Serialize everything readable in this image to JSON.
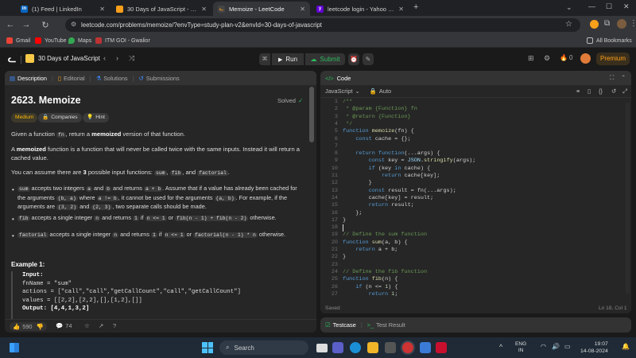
{
  "browser": {
    "tabs": [
      {
        "title": "(1) Feed | LinkedIn",
        "icon": "linkedin-icon"
      },
      {
        "title": "30 Days of JavaScript - Study Pl",
        "icon": "leetcode-icon"
      },
      {
        "title": "Memoize - LeetCode",
        "icon": "leetcode-icon"
      },
      {
        "title": "leetcode login - Yahoo India Se",
        "icon": "yahoo-icon"
      }
    ],
    "url": "leetcode.com/problems/memoize/?envType=study-plan-v2&envId=30-days-of-javascript",
    "bookmarks": [
      "Gmail",
      "YouTube",
      "Maps",
      "ITM GOI - Gwalior"
    ],
    "all_bookmarks": "All Bookmarks"
  },
  "lc_header": {
    "plan": "30 Days of JavaScript",
    "run": "Run",
    "submit": "Submit",
    "coins": "0",
    "premium": "Premium"
  },
  "left_tabs": [
    "Description",
    "Editorial",
    "Solutions",
    "Submissions"
  ],
  "problem": {
    "title": "2623. Memoize",
    "status": "Solved",
    "tags": [
      "Medium",
      "Companies",
      "Hint"
    ],
    "p1a": "Given a function ",
    "p1code": "fn",
    "p1b": ", return a ",
    "p1bold": "memoized",
    "p1c": " version of that function.",
    "p2a": "A ",
    "p2bold": "memoized",
    "p2b": " function is a function that will never be called twice with the same inputs. Instead it will return a",
    "p2c": "cached value.",
    "p3a": "You can assume there are ",
    "p3bold": "3",
    "p3b": " possible input functions: ",
    "p3codes": [
      "sum",
      "fib",
      "factorial"
    ],
    "b1": {
      "c1": "sum",
      "t1": " accepts two integers ",
      "c2": "a",
      "t2": " and ",
      "c3": "b",
      "t3": " and returns ",
      "c4": "a + b",
      "t4": ". Assume that if a value has already been cached for"
    },
    "b1l2": {
      "t1": "the arguments ",
      "c1": "(b, a)",
      "t2": " where ",
      "c2": "a != b",
      "t3": ", it cannot be used for the arguments ",
      "c3": "(a, b)",
      "t4": ". For example, if the"
    },
    "b1l3": {
      "t1": "arguments are ",
      "c1": "(3, 2)",
      "t2": " and ",
      "c2": "(2, 3)",
      "t3": ", two separate calls should be made."
    },
    "b2": {
      "c1": "fib",
      "t1": " accepts a single integer ",
      "c2": "n",
      "t2": " and returns ",
      "c3": "1",
      "t3": " if ",
      "c4": "n <= 1",
      "t4": " or ",
      "c5": "fib(n - 1) + fib(n - 2)",
      "t5": " otherwise."
    },
    "b3": {
      "c1": "factorial",
      "t1": " accepts a single integer ",
      "c2": "n",
      "t2": " and returns ",
      "c3": "1",
      "t3": " if ",
      "c4": "n <= 1",
      "t4": " or ",
      "c5": "factorial(n - 1) * n",
      "t5": " otherwise."
    },
    "example_title": "Example 1:",
    "example_lines": [
      "Input:",
      "fnName = \"sum\"",
      "actions = [\"call\",\"call\",\"getCallCount\",\"call\",\"getCallCount\"]",
      "values = [[2,2],[2,2],[],[1,2],[]]",
      "Output: [4,4,1,3,2]"
    ],
    "likes": "590",
    "comments": "74"
  },
  "editor": {
    "title": "Code",
    "language": "JavaScript",
    "auto": "Auto",
    "saved": "Saved",
    "cursor": "Ln 18, Col 1",
    "lines": [
      "/**",
      " * @param {Function} fn",
      " * @return {Function}",
      " */",
      "function memoize(fn) {",
      "    const cache = {};",
      "",
      "    return function(...args) {",
      "        const key = JSON.stringify(args);",
      "        if (key in cache) {",
      "            return cache[key];",
      "        }",
      "        const result = fn(...args);",
      "        cache[key] = result;",
      "        return result;",
      "    };",
      "}",
      "",
      "// Define the sum function",
      "function sum(a, b) {",
      "    return a + b;",
      "}",
      "",
      "// Define the fib function",
      "function fib(n) {",
      "    if (n <= 1) {",
      "        return 1;"
    ]
  },
  "bottom_tabs": [
    "Testcase",
    "Test Result"
  ],
  "taskbar": {
    "search": "Search",
    "lang1": "ENG",
    "lang2": "IN",
    "time": "19:07",
    "date": "14-08-2024"
  }
}
